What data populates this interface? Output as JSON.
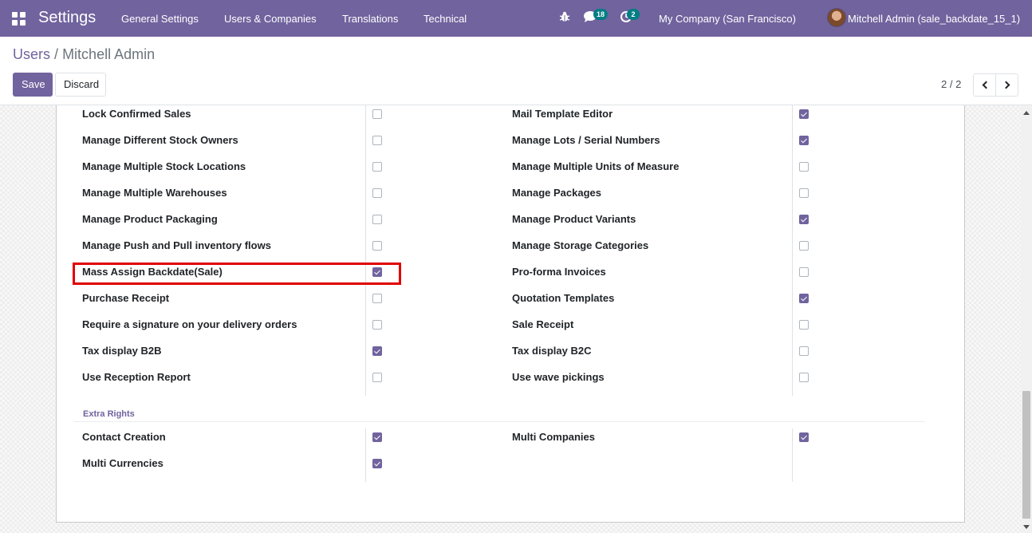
{
  "navbar": {
    "app_title": "Settings",
    "menu": [
      "General Settings",
      "Users & Companies",
      "Translations",
      "Technical"
    ],
    "bug_icon": "bug-icon",
    "messages_count": "18",
    "activities_count": "2",
    "company": "My Company (San Francisco)",
    "user": "Mitchell Admin (sale_backdate_15_1)"
  },
  "breadcrumb": {
    "parent": "Users",
    "separator": "/",
    "current": "Mitchell Admin"
  },
  "buttons": {
    "save": "Save",
    "discard": "Discard"
  },
  "pager": {
    "value": "2 / 2"
  },
  "rights_left": [
    {
      "label": "Lock Confirmed Sales",
      "checked": false
    },
    {
      "label": "Manage Different Stock Owners",
      "checked": false
    },
    {
      "label": "Manage Multiple Stock Locations",
      "checked": false
    },
    {
      "label": "Manage Multiple Warehouses",
      "checked": false
    },
    {
      "label": "Manage Product Packaging",
      "checked": false
    },
    {
      "label": "Manage Push and Pull inventory flows",
      "checked": false
    },
    {
      "label": "Mass Assign Backdate(Sale)",
      "checked": true
    },
    {
      "label": "Purchase Receipt",
      "checked": false
    },
    {
      "label": "Require a signature on your delivery orders",
      "checked": false
    },
    {
      "label": "Tax display B2B",
      "checked": true
    },
    {
      "label": "Use Reception Report",
      "checked": false
    }
  ],
  "rights_right": [
    {
      "label": "Mail Template Editor",
      "checked": true
    },
    {
      "label": "Manage Lots / Serial Numbers",
      "checked": true
    },
    {
      "label": "Manage Multiple Units of Measure",
      "checked": false
    },
    {
      "label": "Manage Packages",
      "checked": false
    },
    {
      "label": "Manage Product Variants",
      "checked": true
    },
    {
      "label": "Manage Storage Categories",
      "checked": false
    },
    {
      "label": "Pro-forma Invoices",
      "checked": false
    },
    {
      "label": "Quotation Templates",
      "checked": true
    },
    {
      "label": "Sale Receipt",
      "checked": false
    },
    {
      "label": "Tax display B2C",
      "checked": false
    },
    {
      "label": "Use wave pickings",
      "checked": false
    }
  ],
  "extra_rights": {
    "title": "Extra Rights",
    "left": [
      {
        "label": "Contact Creation",
        "checked": true
      },
      {
        "label": "Multi Currencies",
        "checked": true
      }
    ],
    "right": [
      {
        "label": "Multi Companies",
        "checked": true
      }
    ]
  },
  "colors": {
    "brand": "#71639e",
    "badge": "#017e84",
    "highlight": "#e00000"
  }
}
